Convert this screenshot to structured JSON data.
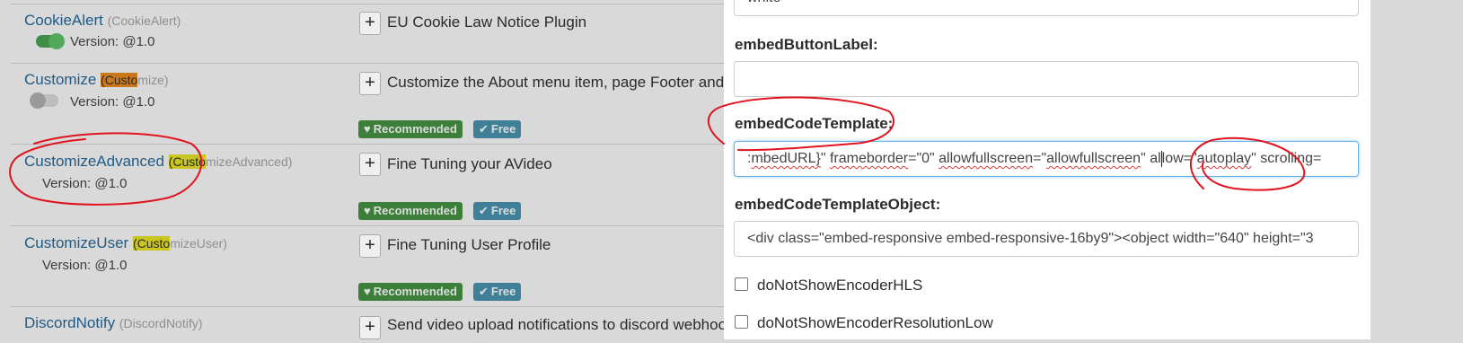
{
  "plugins": [
    {
      "name": "CookieAlert",
      "sub_pre": "",
      "sub_hl": "",
      "sub_post": "(CookieAlert)",
      "version": "Version: @1.0",
      "enabled": true,
      "description": "EU Cookie Law Notice Plugin"
    },
    {
      "name": "Customize",
      "sub_pre": "(",
      "sub_hl": "Custo",
      "sub_post": "mize)",
      "version": "Version: @1.0",
      "enabled": false,
      "description": "Customize the About menu item, page Footer and",
      "badges": [
        "Recommended",
        "Free"
      ]
    },
    {
      "name": "CustomizeAdvanced",
      "sub_pre": "(",
      "sub_hl": "Custo",
      "sub_post": "mizeAdvanced)",
      "version": "Version: @1.0",
      "description": "Fine Tuning your AVideo",
      "badges": [
        "Recommended",
        "Free"
      ]
    },
    {
      "name": "CustomizeUser",
      "sub_pre": "(",
      "sub_hl": "Custo",
      "sub_post": "mizeUser)",
      "version": "Version: @1.0",
      "description": "Fine Tuning User Profile",
      "badges": [
        "Recommended",
        "Free"
      ]
    },
    {
      "name": "DiscordNotify",
      "sub_post": "(DiscordNotify)",
      "description": "Send video upload notifications to discord webhoo"
    }
  ],
  "modal": {
    "top_input_value": "white",
    "fields": {
      "embedButtonLabel": {
        "label": "embedButtonLabel:",
        "value": ""
      },
      "embedCodeTemplate": {
        "label": "embedCodeTemplate:",
        "value_parts": [
          ":",
          "mbedURL}",
          "\" ",
          "frameborder",
          "=\"0\" ",
          "allowfullscreen",
          "=\"",
          "allowfullscreen",
          "\" al",
          "low=\"",
          "autoplay",
          "\" scrolling="
        ]
      },
      "embedCodeTemplateObject": {
        "label": "embedCodeTemplateObject:",
        "value": "<div class=\"embed-responsive embed-responsive-16by9\"><object width=\"640\" height=\"3"
      }
    },
    "checkboxes": [
      {
        "label": "doNotShowEncoderHLS",
        "checked": false
      },
      {
        "label": "doNotShowEncoderResolutionLow",
        "checked": false
      }
    ]
  },
  "icons": {
    "plus": "+",
    "heart": "♥",
    "check": "✔"
  },
  "colors": {
    "annotation_red": "#e0141e",
    "link_blue": "#1f5a86",
    "badge_green": "#3b7f3a",
    "badge_blue": "#3f7f97"
  }
}
